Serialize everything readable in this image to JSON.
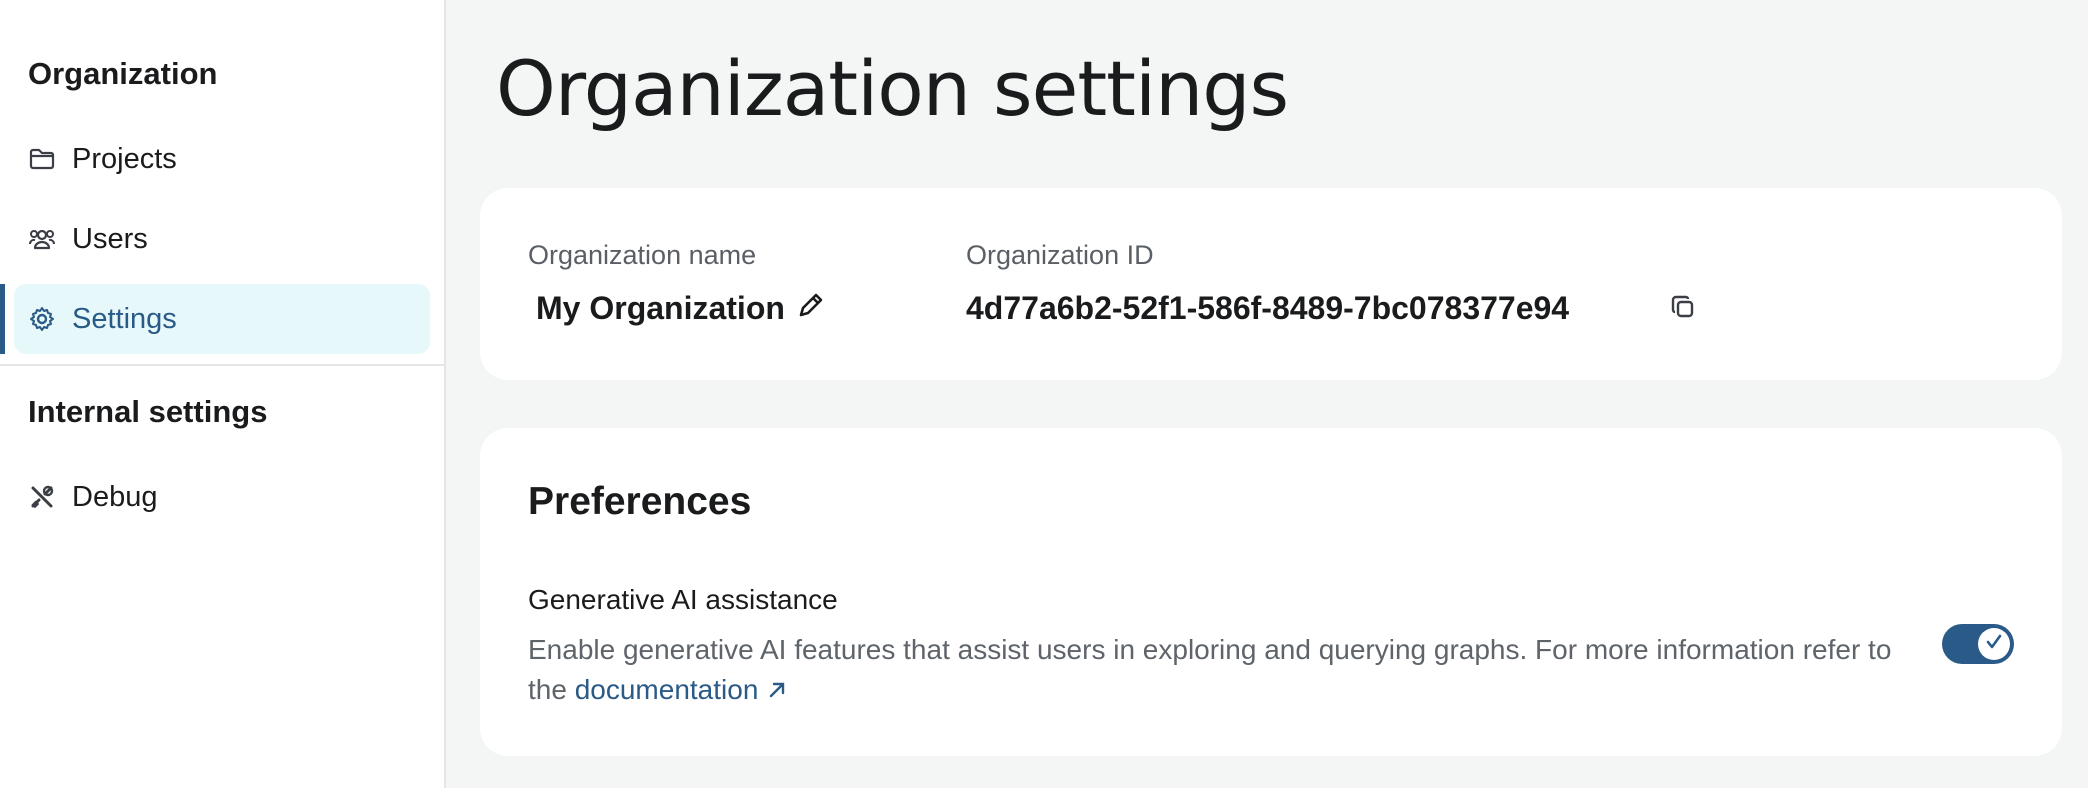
{
  "sidebar": {
    "organization_heading": "Organization",
    "items": [
      {
        "label": "Projects",
        "icon": "folder-icon"
      },
      {
        "label": "Users",
        "icon": "users-icon"
      },
      {
        "label": "Settings",
        "icon": "gear-icon",
        "active": true
      }
    ],
    "internal_heading": "Internal settings",
    "internal_items": [
      {
        "label": "Debug",
        "icon": "tools-icon"
      }
    ]
  },
  "page": {
    "title": "Organization settings"
  },
  "org_card": {
    "name_label": "Organization name",
    "name_value": "My Organization",
    "id_label": "Organization ID",
    "id_value": "4d77a6b2-52f1-586f-8489-7bc078377e94"
  },
  "preferences": {
    "title": "Preferences",
    "ai_title": "Generative AI assistance",
    "ai_desc": "Enable generative AI features that assist users in exploring and querying graphs. For more information refer to the",
    "ai_link": "documentation",
    "ai_enabled": true
  },
  "colors": {
    "accent": "#2a5a87",
    "active_bg": "#e6f8f9",
    "page_bg": "#f4f6f5"
  }
}
